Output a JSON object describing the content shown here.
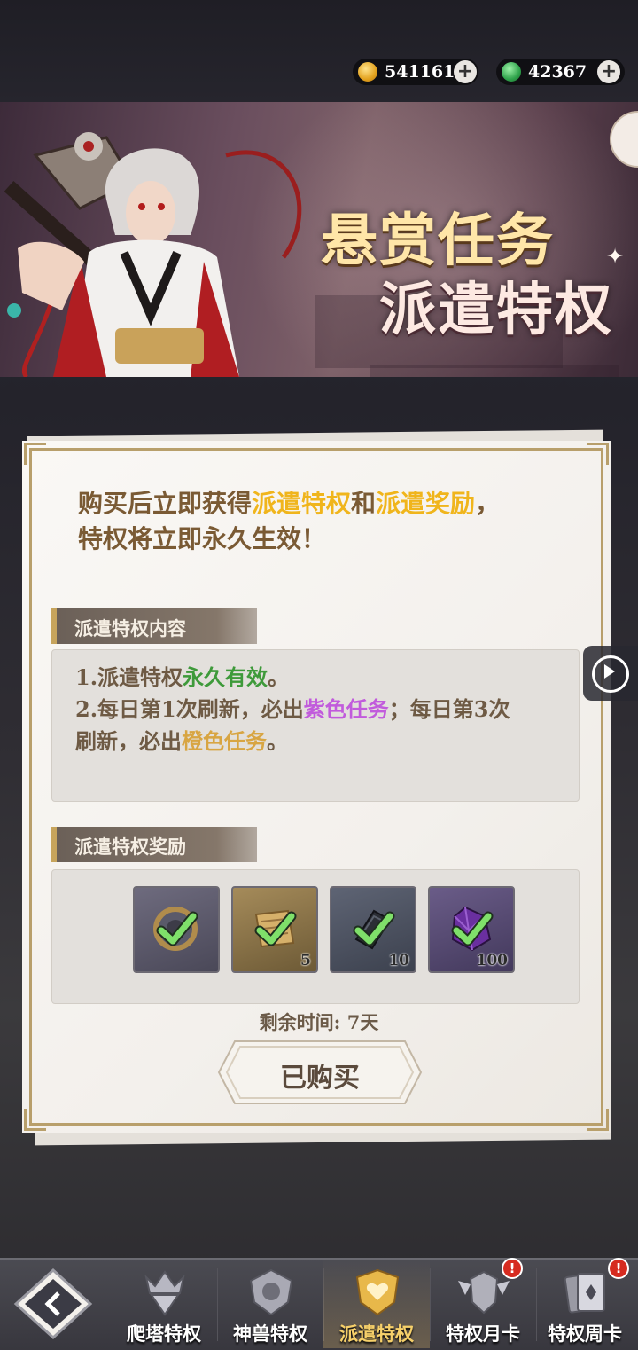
{
  "currency": {
    "gold": {
      "value": "541161",
      "icon": "gold-coin-icon"
    },
    "jade": {
      "value": "42367",
      "icon": "jade-coin-icon"
    },
    "plus": "+"
  },
  "banner": {
    "title_line1": "悬赏任务",
    "title_line2": "派遣特权"
  },
  "card": {
    "intro_a": "购买后立即获得",
    "intro_hl1": "派遣特权",
    "intro_and": "和",
    "intro_hl2": "派遣奖励",
    "intro_comma": "，",
    "intro_line2": "特权将立即永久生效！",
    "section1": "派遣特权内容",
    "desc1_a": "1.派遣特权",
    "desc1_b": "永久有效",
    "desc1_c": "。",
    "desc2_a": "2.每日第1次刷新，必出",
    "desc2_b": "紫色任务",
    "desc2_c": "；每日第3次",
    "desc3_a": "刷新，必出",
    "desc3_b": "橙色任务",
    "desc3_c": "。",
    "section2": "派遣特权奖励",
    "rewards": [
      {
        "name": "emblem-icon",
        "count": ""
      },
      {
        "name": "scroll-icon",
        "count": "5"
      },
      {
        "name": "dark-token-icon",
        "count": "10"
      },
      {
        "name": "purple-crystal-icon",
        "count": "100"
      }
    ],
    "remaining_time": "剩余时间: 7天",
    "buy_button": "已购买"
  },
  "nav": {
    "tabs": [
      "爬塔特权",
      "神兽特权",
      "派遣特权",
      "特权月卡",
      "特权周卡"
    ],
    "badge": "!"
  },
  "colors": {
    "highlight": "#f0b51c",
    "green": "#3e9a3a",
    "purple": "#c15bdc",
    "orange": "#d8a542",
    "card_border": "#b89f6b"
  }
}
